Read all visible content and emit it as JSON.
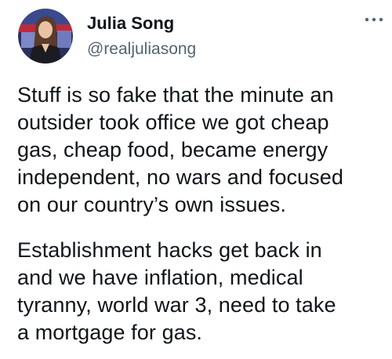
{
  "tweet": {
    "author": {
      "display_name": "Julia Song",
      "handle": "@realjuliasong",
      "avatar": "profile-photo"
    },
    "more_icon": "more-horizontal-icon",
    "paragraphs": [
      {
        "lines": [
          "Stuff is so fake that the minute an",
          "outsider took office we got cheap",
          "gas, cheap food, became energy",
          "independent, no wars and focused",
          "on our country’s own issues."
        ]
      },
      {
        "lines": [
          "Establishment hacks get back in",
          "and we have inflation, medical",
          "tyranny, world war 3, need to take",
          "a mortgage for gas."
        ]
      }
    ]
  },
  "colors": {
    "text_primary": "#0f1419",
    "text_secondary": "#536471",
    "background": "#ffffff"
  }
}
